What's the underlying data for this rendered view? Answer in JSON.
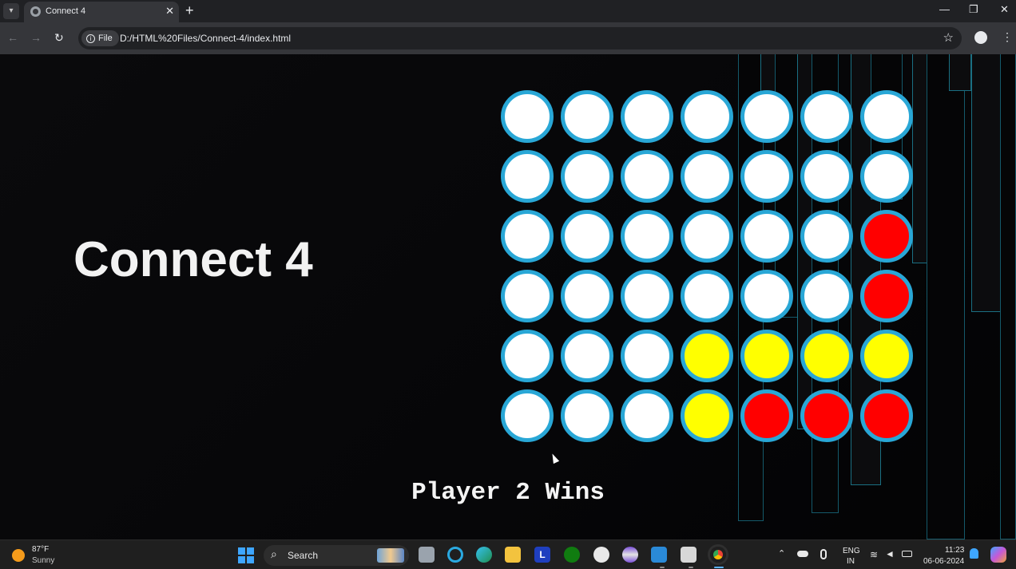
{
  "browser": {
    "tab_title": "Connect 4",
    "tab_close": "✕",
    "new_tab": "+",
    "file_chip": "File",
    "url": "D:/HTML%20Files/Connect-4/index.html",
    "window_controls": {
      "minimize": "—",
      "restore": "❐",
      "close": "✕"
    }
  },
  "game": {
    "title": "Connect 4",
    "result": "Player 2 Wins",
    "colors": {
      "empty": "#ffffff",
      "red": "#ff0000",
      "yellow": "#ffff00",
      "rim": "#29a7d6"
    },
    "board": [
      [
        "empty",
        "empty",
        "empty",
        "empty",
        "empty",
        "empty",
        "empty"
      ],
      [
        "empty",
        "empty",
        "empty",
        "empty",
        "empty",
        "empty",
        "empty"
      ],
      [
        "empty",
        "empty",
        "empty",
        "empty",
        "empty",
        "empty",
        "red"
      ],
      [
        "empty",
        "empty",
        "empty",
        "empty",
        "empty",
        "empty",
        "red"
      ],
      [
        "empty",
        "empty",
        "empty",
        "yellow",
        "yellow",
        "yellow",
        "yellow"
      ],
      [
        "empty",
        "empty",
        "empty",
        "yellow",
        "red",
        "red",
        "red"
      ]
    ]
  },
  "taskbar": {
    "weather_temp": "87°F",
    "weather_desc": "Sunny",
    "search_placeholder": "Search",
    "lang_top": "ENG",
    "lang_bottom": "IN",
    "time": "11:23",
    "date": "06-06-2024"
  }
}
